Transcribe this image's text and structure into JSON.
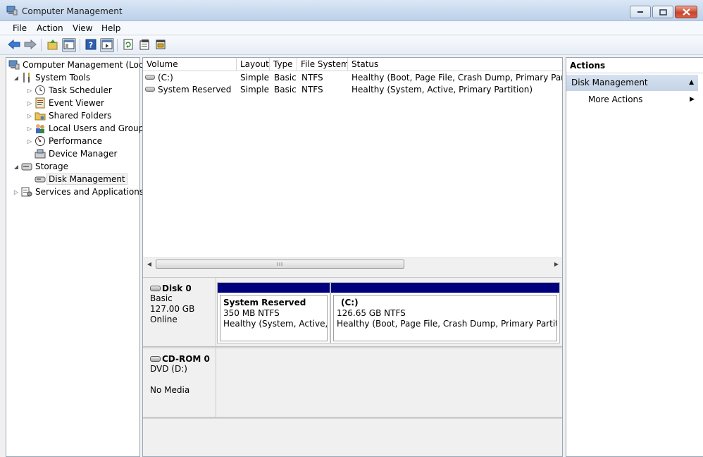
{
  "window": {
    "title": "Computer Management",
    "buttons": {
      "minimize": "minimize",
      "maximize": "maximize",
      "close": "close"
    }
  },
  "menu": {
    "items": [
      "File",
      "Action",
      "View",
      "Help"
    ]
  },
  "toolbar": {
    "buttons": [
      {
        "icon": "back-arrow-icon"
      },
      {
        "icon": "forward-arrow-icon"
      },
      {
        "icon": "up-level-icon"
      },
      {
        "icon": "show-hide-console-tree-icon",
        "pressed": true
      },
      {
        "icon": "help-icon"
      },
      {
        "icon": "show-hide-action-pane-icon",
        "pressed": true
      },
      {
        "icon": "refresh-icon"
      },
      {
        "icon": "properties-icon"
      },
      {
        "icon": "disk-properties-icon"
      }
    ]
  },
  "tree": {
    "root": "Computer Management (Local",
    "items": [
      {
        "label": "System Tools",
        "expanded": true,
        "icon": "tools-icon"
      },
      {
        "label": "Task Scheduler",
        "icon": "clock-icon"
      },
      {
        "label": "Event Viewer",
        "icon": "event-log-icon"
      },
      {
        "label": "Shared Folders",
        "icon": "shared-folder-icon"
      },
      {
        "label": "Local Users and Groups",
        "icon": "users-icon"
      },
      {
        "label": "Performance",
        "icon": "performance-icon"
      },
      {
        "label": "Device Manager",
        "icon": "device-manager-icon"
      },
      {
        "label": "Storage",
        "expanded": true,
        "icon": "storage-icon"
      },
      {
        "label": "Disk Management",
        "selected": true,
        "icon": "disk-icon"
      },
      {
        "label": "Services and Applications",
        "icon": "services-icon"
      }
    ]
  },
  "volumes": {
    "headers": [
      "Volume",
      "Layout",
      "Type",
      "File System",
      "Status"
    ],
    "rows": [
      {
        "volume": "(C:)",
        "layout": "Simple",
        "type": "Basic",
        "fs": "NTFS",
        "status": "Healthy (Boot, Page File, Crash Dump, Primary Partition)"
      },
      {
        "volume": "System Reserved",
        "layout": "Simple",
        "type": "Basic",
        "fs": "NTFS",
        "status": "Healthy (System, Active, Primary Partition)"
      }
    ],
    "scroll_thumb_glyph": "III"
  },
  "disks": [
    {
      "name": "Disk 0",
      "lines": [
        "Basic",
        "127.00 GB",
        "Online"
      ],
      "partitions": [
        {
          "name": "System Reserved",
          "size": "350 MB NTFS",
          "status": "Healthy (System, Active, Pri"
        },
        {
          "name": "(C:)",
          "size": "126.65 GB NTFS",
          "status": "Healthy (Boot, Page File, Crash Dump, Primary Partition)"
        }
      ]
    },
    {
      "name": "CD-ROM 0",
      "lines": [
        "DVD (D:)",
        "",
        "No Media"
      ]
    }
  ],
  "actions": {
    "title": "Actions",
    "group": "Disk Management",
    "items": [
      "More Actions"
    ]
  },
  "colors": {
    "partition_bar": "#00007f",
    "selection_bg": "#c4d3e6"
  }
}
